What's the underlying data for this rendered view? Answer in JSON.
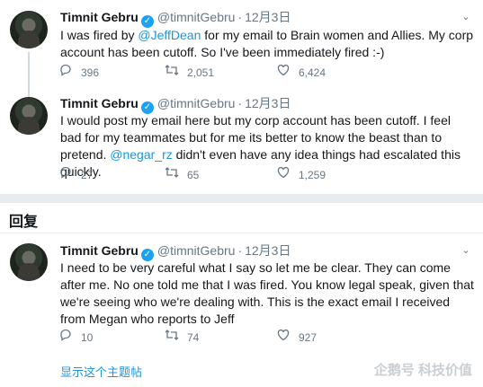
{
  "tweets": [
    {
      "name": "Timnit Gebru",
      "handle": "@timnitGebru",
      "date": "12月3日",
      "text_before": "I was fired by ",
      "mention": "@JeffDean",
      "text_after": " for my email to Brain women and Allies. My corp account has been cutoff. So I've been immediately fired :-)",
      "replies": "396",
      "retweets": "2,051",
      "likes": "6,424"
    },
    {
      "name": "Timnit Gebru",
      "handle": "@timnitGebru",
      "date": "12月3日",
      "text_before": "I would post my email here but my corp account has been cutoff. I feel bad for my teammates but for me its better to know the beast than to pretend. ",
      "mention": "@negar_rz",
      "text_after": " didn't even have any idea things had escalated this quickly.",
      "replies": "27",
      "retweets": "65",
      "likes": "1,259"
    },
    {
      "name": "Timnit Gebru",
      "handle": "@timnitGebru",
      "date": "12月3日",
      "text_before": "I need to be very careful what I say so let me be clear. They can come after me. No one told me that I was fired. You know legal speak, given that we're seeing who we're dealing with. This is the exact email I received from Megan who reports to Jeff",
      "mention": "",
      "text_after": "",
      "replies": "10",
      "retweets": "74",
      "likes": "927"
    }
  ],
  "section_title": "回复",
  "show_thread": "显示这个主题帖",
  "watermark": "企鹅号 科技价值",
  "icons": {
    "verified": "verified-badge-icon",
    "more": "chevron-down-icon",
    "reply": "reply-icon",
    "retweet": "retweet-icon",
    "like": "heart-icon"
  },
  "colors": {
    "link": "#1b95e0",
    "verified": "#1da1f2",
    "muted": "#657786"
  }
}
